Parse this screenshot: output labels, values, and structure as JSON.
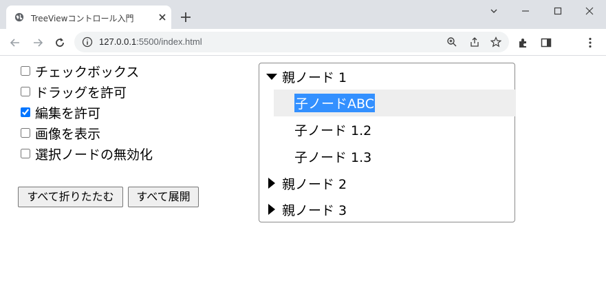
{
  "browser": {
    "tab_title": "TreeViewコントロール入門",
    "url_host": "127.0.0.1",
    "url_rest": ":5500/index.html"
  },
  "options": [
    {
      "label": "チェックボックス",
      "checked": false
    },
    {
      "label": "ドラッグを許可",
      "checked": false
    },
    {
      "label": "編集を許可",
      "checked": true
    },
    {
      "label": "画像を表示",
      "checked": false
    },
    {
      "label": "選択ノードの無効化",
      "checked": false
    }
  ],
  "buttons": {
    "collapse_all": "すべて折りたたむ",
    "expand_all": "すべて展開"
  },
  "tree": {
    "nodes": [
      {
        "label": "親ノード 1",
        "expanded": true
      },
      {
        "label": "子ノードABC",
        "selected": true
      },
      {
        "label": "子ノード 1.2"
      },
      {
        "label": "子ノード 1.3"
      },
      {
        "label": "親ノード 2",
        "expanded": false
      },
      {
        "label": "親ノード 3",
        "expanded": false
      }
    ]
  }
}
